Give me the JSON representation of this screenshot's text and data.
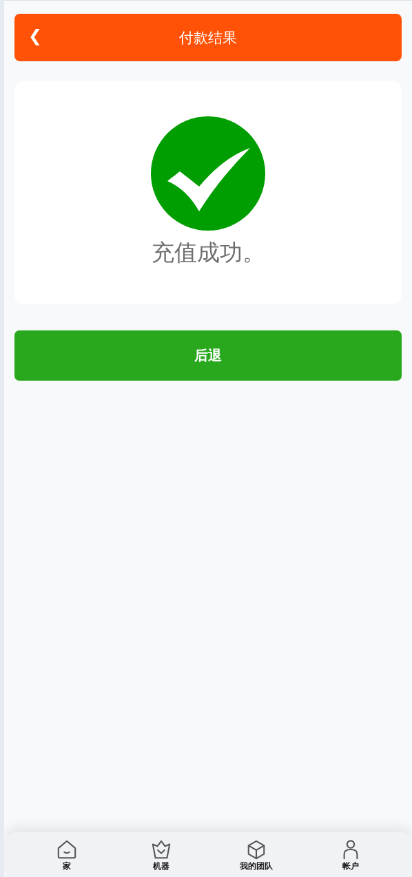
{
  "header": {
    "back_glyph": "❮",
    "title": "付款结果"
  },
  "result": {
    "message": "充值成功。"
  },
  "back_button": {
    "label": "后退"
  },
  "bottom_nav": [
    {
      "kind": "home",
      "label": "家"
    },
    {
      "kind": "crown",
      "label": "机器"
    },
    {
      "kind": "cube",
      "label": "我的团队"
    },
    {
      "kind": "person",
      "label": "帐户"
    }
  ]
}
